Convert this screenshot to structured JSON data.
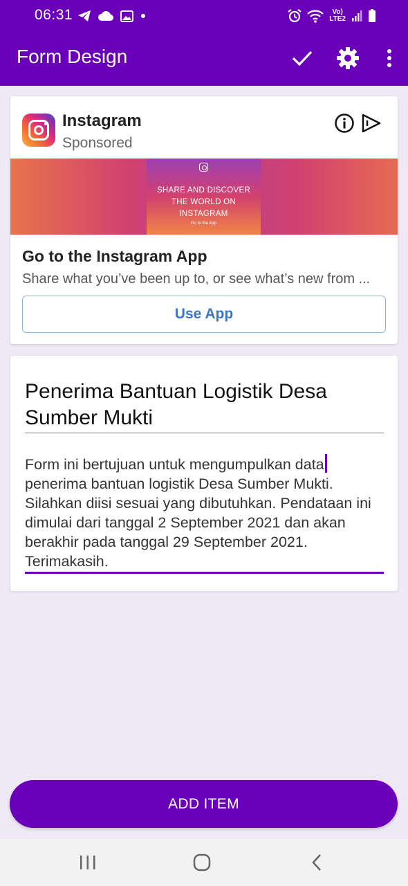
{
  "status_bar": {
    "time": "06:31",
    "lte_top": "Vo)",
    "lte_bottom": "LTE2"
  },
  "app_bar": {
    "title": "Form Design",
    "icons": [
      "check-icon",
      "gear-icon",
      "more-vert-icon"
    ]
  },
  "ad": {
    "advertiser": "Instagram",
    "sponsored_label": "Sponsored",
    "banner_line1": "SHARE AND DISCOVER",
    "banner_line2": "THE WORLD ON INSTAGRAM",
    "banner_small": "Go to the App",
    "headline": "Go to the Instagram App",
    "body": "Share what you’ve been up to, or see what’s new from ...",
    "cta_label": "Use App"
  },
  "form": {
    "title": "Penerima Bantuan Logistik Desa Sumber Mukti",
    "description_line1": "Form ini bertujuan untuk mengumpulkan data",
    "description_rest": "penerima bantuan logistik Desa Sumber Mukti. Silahkan diisi sesuai yang dibutuhkan. Pendataan ini dimulai dari tanggal 2 September 2021 dan akan berakhir pada tanggal 29 September 2021. Terimakasih."
  },
  "add_item_label": "ADD ITEM",
  "colors": {
    "primary": "#6a00b9",
    "background": "#efe9f6",
    "cta_text": "#3b77c9"
  }
}
